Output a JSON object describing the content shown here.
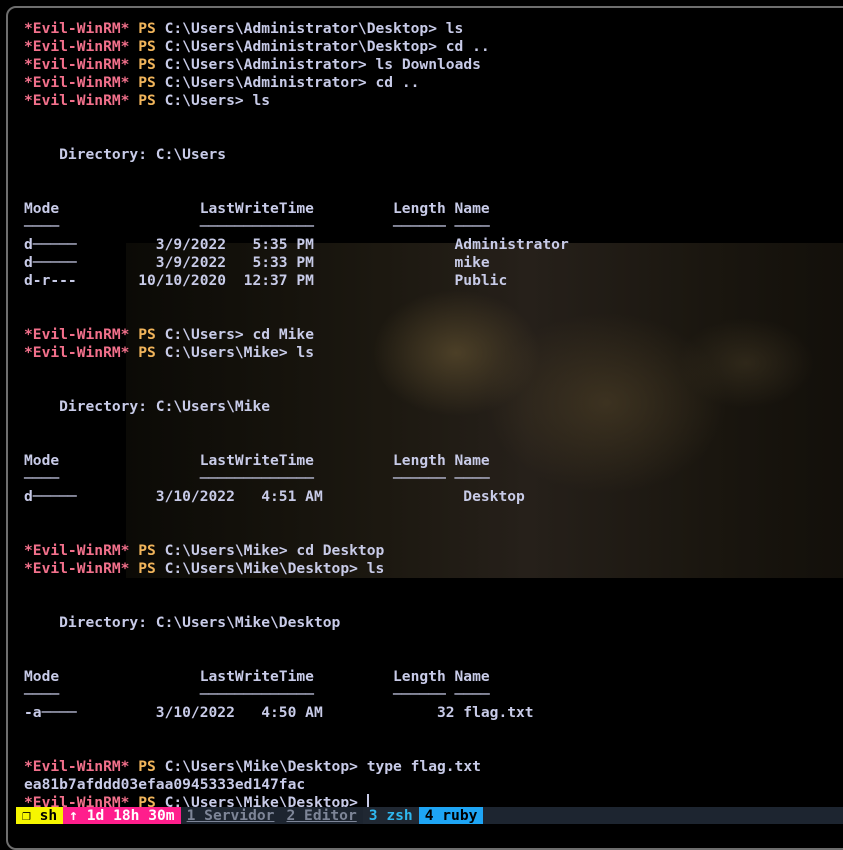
{
  "prompt_user": "*Evil-WinRM*",
  "prompt_ps": "PS",
  "lines": [
    {
      "type": "cmd",
      "path": "C:\\Users\\Administrator\\Desktop>",
      "cmd": " ls"
    },
    {
      "type": "cmd",
      "path": "C:\\Users\\Administrator\\Desktop>",
      "cmd": " cd .."
    },
    {
      "type": "cmd",
      "path": "C:\\Users\\Administrator>",
      "cmd": " ls Downloads"
    },
    {
      "type": "cmd",
      "path": "C:\\Users\\Administrator>",
      "cmd": " cd .."
    },
    {
      "type": "cmd",
      "path": "C:\\Users>",
      "cmd": " ls"
    },
    {
      "type": "text",
      "text": ""
    },
    {
      "type": "text",
      "text": ""
    },
    {
      "type": "text",
      "text": "    Directory: C:\\Users"
    },
    {
      "type": "text",
      "text": ""
    },
    {
      "type": "text",
      "text": ""
    },
    {
      "type": "text",
      "text": "Mode                LastWriteTime         Length Name"
    },
    {
      "type": "text",
      "text": "────                ─────────────         ────── ────"
    },
    {
      "type": "text",
      "text": "d─────         3/9/2022   5:35 PM                Administrator"
    },
    {
      "type": "text",
      "text": "d─────         3/9/2022   5:33 PM                mike"
    },
    {
      "type": "text",
      "text": "d-r---       10/10/2020  12:37 PM                Public"
    },
    {
      "type": "text",
      "text": ""
    },
    {
      "type": "text",
      "text": ""
    },
    {
      "type": "cmd",
      "path": "C:\\Users>",
      "cmd": " cd Mike"
    },
    {
      "type": "cmd",
      "path": "C:\\Users\\Mike>",
      "cmd": " ls"
    },
    {
      "type": "text",
      "text": ""
    },
    {
      "type": "text",
      "text": ""
    },
    {
      "type": "text",
      "text": "    Directory: C:\\Users\\Mike"
    },
    {
      "type": "text",
      "text": ""
    },
    {
      "type": "text",
      "text": ""
    },
    {
      "type": "text",
      "text": "Mode                LastWriteTime         Length Name"
    },
    {
      "type": "text",
      "text": "────                ─────────────         ────── ────"
    },
    {
      "type": "text",
      "text": "d─────         3/10/2022   4:51 AM                Desktop"
    },
    {
      "type": "text",
      "text": ""
    },
    {
      "type": "text",
      "text": ""
    },
    {
      "type": "cmd",
      "path": "C:\\Users\\Mike>",
      "cmd": " cd Desktop"
    },
    {
      "type": "cmd",
      "path": "C:\\Users\\Mike\\Desktop>",
      "cmd": " ls"
    },
    {
      "type": "text",
      "text": ""
    },
    {
      "type": "text",
      "text": ""
    },
    {
      "type": "text",
      "text": "    Directory: C:\\Users\\Mike\\Desktop"
    },
    {
      "type": "text",
      "text": ""
    },
    {
      "type": "text",
      "text": ""
    },
    {
      "type": "text",
      "text": "Mode                LastWriteTime         Length Name"
    },
    {
      "type": "text",
      "text": "────                ─────────────         ────── ────"
    },
    {
      "type": "text",
      "text": "-a────         3/10/2022   4:50 AM             32 flag.txt"
    },
    {
      "type": "text",
      "text": ""
    },
    {
      "type": "text",
      "text": ""
    },
    {
      "type": "cmd",
      "path": "C:\\Users\\Mike\\Desktop>",
      "cmd": " type flag.txt"
    },
    {
      "type": "text",
      "text": "ea81b7afddd03efaa0945333ed147fac"
    },
    {
      "type": "cmd",
      "path": "C:\\Users\\Mike\\Desktop>",
      "cmd": " ",
      "cursor": true
    }
  ],
  "statusbar": {
    "session": "❐ sh",
    "uptime": "↑ 1d 18h 30m",
    "windows": [
      "1 Servidor",
      "2 Editor",
      "3 zsh",
      "4 ruby"
    ]
  },
  "colors": {
    "prompt_user": "#f2708b",
    "prompt_ps": "#f0b45b",
    "text": "#c8cbe8"
  }
}
